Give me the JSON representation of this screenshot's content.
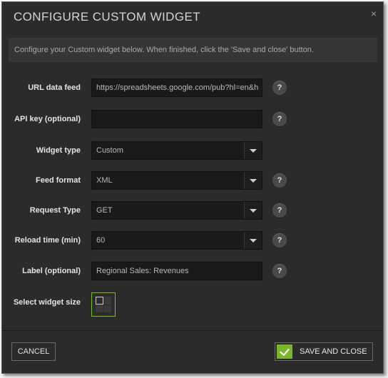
{
  "dialog": {
    "title": "CONFIGURE CUSTOM WIDGET",
    "close_glyph": "×",
    "info_text": "Configure your Custom widget below. When finished, click the 'Save and close' button."
  },
  "form": {
    "url_data_feed": {
      "label": "URL data feed",
      "value": "https://spreadsheets.google.com/pub?hl=en&h"
    },
    "api_key": {
      "label": "API key (optional)",
      "value": ""
    },
    "widget_type": {
      "label": "Widget type",
      "value": "Custom"
    },
    "feed_format": {
      "label": "Feed format",
      "value": "XML"
    },
    "request_type": {
      "label": "Request Type",
      "value": "GET"
    },
    "reload_time": {
      "label": "Reload time (min)",
      "value": "60"
    },
    "label_field": {
      "label": "Label (optional)",
      "value": "Regional Sales: Revenues"
    },
    "widget_size": {
      "label": "Select widget size"
    },
    "help_glyph": "?"
  },
  "footer": {
    "cancel_label": "CANCEL",
    "save_label": "SAVE AND CLOSE"
  },
  "colors": {
    "accent_green": "#79b62a",
    "dialog_bg": "#2b2b2b"
  },
  "icons": [
    "close-icon",
    "help-icon",
    "chevron-down-icon",
    "checkmark-icon",
    "widget-size-grid-icon"
  ]
}
